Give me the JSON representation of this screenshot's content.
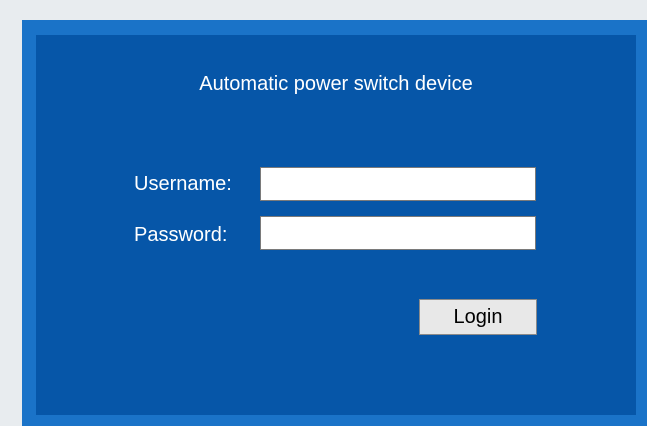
{
  "login": {
    "title": "Automatic power switch device",
    "username_label": "Username:",
    "username_value": "",
    "password_label": "Password:",
    "password_value": "",
    "login_button": "Login"
  },
  "colors": {
    "panel_background": "#0656a8",
    "frame_border": "#1a73c8",
    "text": "#ffffff",
    "button_background": "#e8e8e8"
  }
}
